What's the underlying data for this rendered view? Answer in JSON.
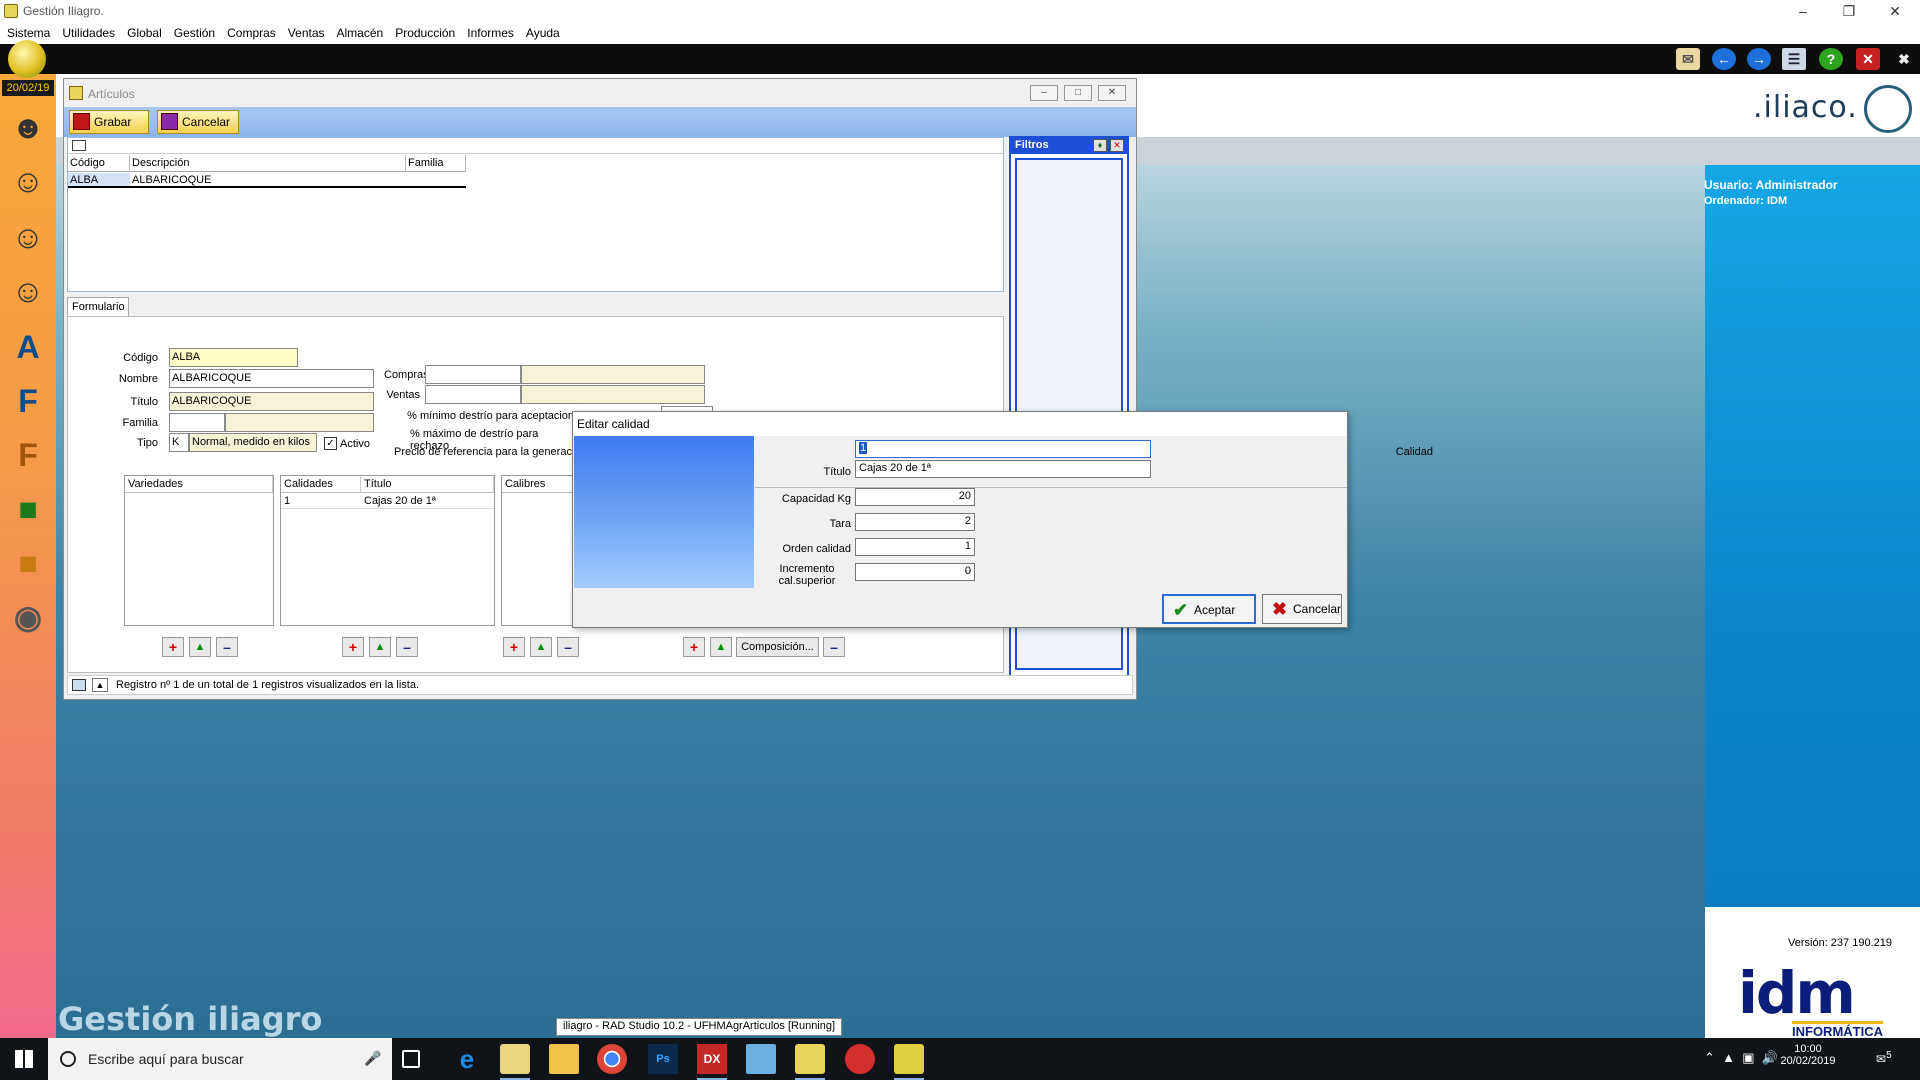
{
  "window": {
    "title": "Gestión Iliagro."
  },
  "menu": [
    "Sistema",
    "Utilidades",
    "Global",
    "Gestión",
    "Compras",
    "Ventas",
    "Almacén",
    "Producción",
    "Informes",
    "Ayuda"
  ],
  "dock": {
    "date": "20/02/19"
  },
  "desktop": {
    "user": "Usuario: Administrador",
    "computer": "Ordenador:  IDM",
    "version": "Versión: 237 190.219",
    "logo": ".iliaco.",
    "idm": "idm",
    "idm_sub": "INFORMÁTICA",
    "watermark": "Gestión iliagro",
    "tooltip": "iliagro - RAD Studio 10.2 - UFHMAgrArticulos [Running]"
  },
  "articulos": {
    "title": "Artículos",
    "save_label": "Grabar",
    "cancel_label": "Cancelar",
    "grid": {
      "columns": [
        "Código",
        "Descripción",
        "Familia"
      ],
      "rows": [
        [
          "ALBA",
          "ALBARICOQUE",
          ""
        ]
      ]
    },
    "filtros_title": "Filtros",
    "tab": "Formulario",
    "form": {
      "codigo_label": "Código",
      "codigo": "ALBA",
      "nombre_label": "Nombre",
      "nombre": "ALBARICOQUE",
      "titulo_label": "Título",
      "titulo": "ALBARICOQUE",
      "familia_label": "Familia",
      "familia": "",
      "tipo_label": "Tipo",
      "tipo_code": "K",
      "tipo_desc": "Normal, medido en kilos",
      "activo_label": "Activo",
      "activo": true,
      "compras_label": "Compras",
      "ventas_label": "Ventas",
      "min_destrio_label": "% mínimo destrío para aceptacion auto de partidas",
      "max_destrio_label": "% máximo de destrío para rechazo",
      "precio_ref_label": "Precio de referencia para la generac"
    },
    "variedades": {
      "header": "Variedades"
    },
    "calidades": {
      "headers": [
        "Calidades",
        "Título"
      ],
      "rows": [
        [
          "1",
          "Cajas 20 de 1ª"
        ]
      ]
    },
    "calibres": {
      "header": "Calibres"
    },
    "composicion_label": "Composición...",
    "status": "Registro nº 1 de un total de 1 registros visualizados en la lista."
  },
  "dialog": {
    "title": "Editar calidad",
    "calidad_label": "Calidad",
    "calidad": "1",
    "titulo_label": "Título",
    "titulo": "Cajas 20 de 1ª",
    "capacidad_label": "Capacidad Kg",
    "capacidad": "20",
    "tara_label": "Tara",
    "tara": "2",
    "orden_label": "Orden calidad",
    "orden": "1",
    "incremento_label_1": "Incremento",
    "incremento_label_2": "cal.superior",
    "incremento": "0",
    "accept_label": "Aceptar",
    "cancel_label": "Cancelar"
  },
  "taskbar": {
    "search_placeholder": "Escribe aquí para buscar",
    "time": "10:00",
    "date": "20/02/2019",
    "notifications": "5"
  }
}
